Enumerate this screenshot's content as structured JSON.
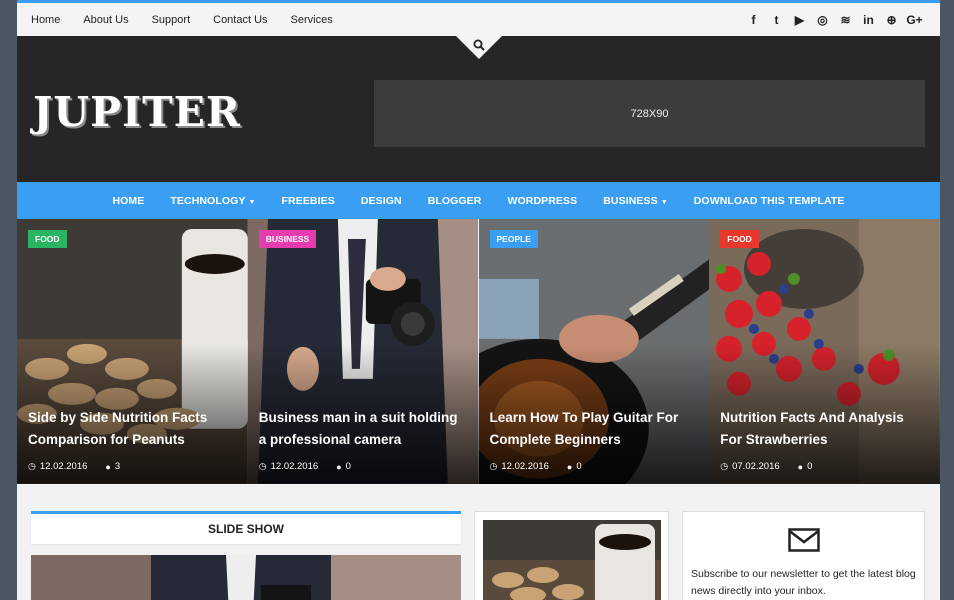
{
  "topnav": [
    "Home",
    "About Us",
    "Support",
    "Contact Us",
    "Services"
  ],
  "social_icons": [
    "facebook-icon",
    "twitter-icon",
    "youtube-icon",
    "instagram-icon",
    "rss-icon",
    "linkedin-icon",
    "dribbble-icon",
    "google-plus-icon"
  ],
  "social_glyphs": [
    "f",
    "t",
    "▶",
    "◎",
    "≋",
    "in",
    "⊕",
    "G+"
  ],
  "logo": "JUPITER",
  "ad_label": "728X90",
  "mainnav": [
    {
      "label": "HOME",
      "dropdown": false
    },
    {
      "label": "TECHNOLOGY",
      "dropdown": true
    },
    {
      "label": "FREEBIES",
      "dropdown": false
    },
    {
      "label": "DESIGN",
      "dropdown": false
    },
    {
      "label": "BLOGGER",
      "dropdown": false
    },
    {
      "label": "WORDPRESS",
      "dropdown": false
    },
    {
      "label": "BUSINESS",
      "dropdown": true
    },
    {
      "label": "DOWNLOAD THIS TEMPLATE",
      "dropdown": false
    }
  ],
  "featured": [
    {
      "tag": "FOOD",
      "tag_color": "#28b463",
      "title": "Side by Side Nutrition Facts Comparison for Peanuts",
      "date": "12.02.2016",
      "comments": "3"
    },
    {
      "tag": "BUSINESS",
      "tag_color": "#e63cae",
      "title": "Business man in a suit holding a professional camera",
      "date": "12.02.2016",
      "comments": "0"
    },
    {
      "tag": "PEOPLE",
      "tag_color": "#3a9ff2",
      "title": "Learn How To Play Guitar For Complete Beginners",
      "date": "12.02.2016",
      "comments": "0"
    },
    {
      "tag": "FOOD",
      "tag_color": "#e8372c",
      "title": "Nutrition Facts And Analysis For Strawberries",
      "date": "07.02.2016",
      "comments": "0"
    }
  ],
  "slideshow_title": "SLIDE SHOW",
  "newsletter_text": "Subscribe to our newsletter to get the latest blog news directly into your inbox.",
  "colors": {
    "accent": "#3a9ff2",
    "header_bg": "#262626"
  }
}
